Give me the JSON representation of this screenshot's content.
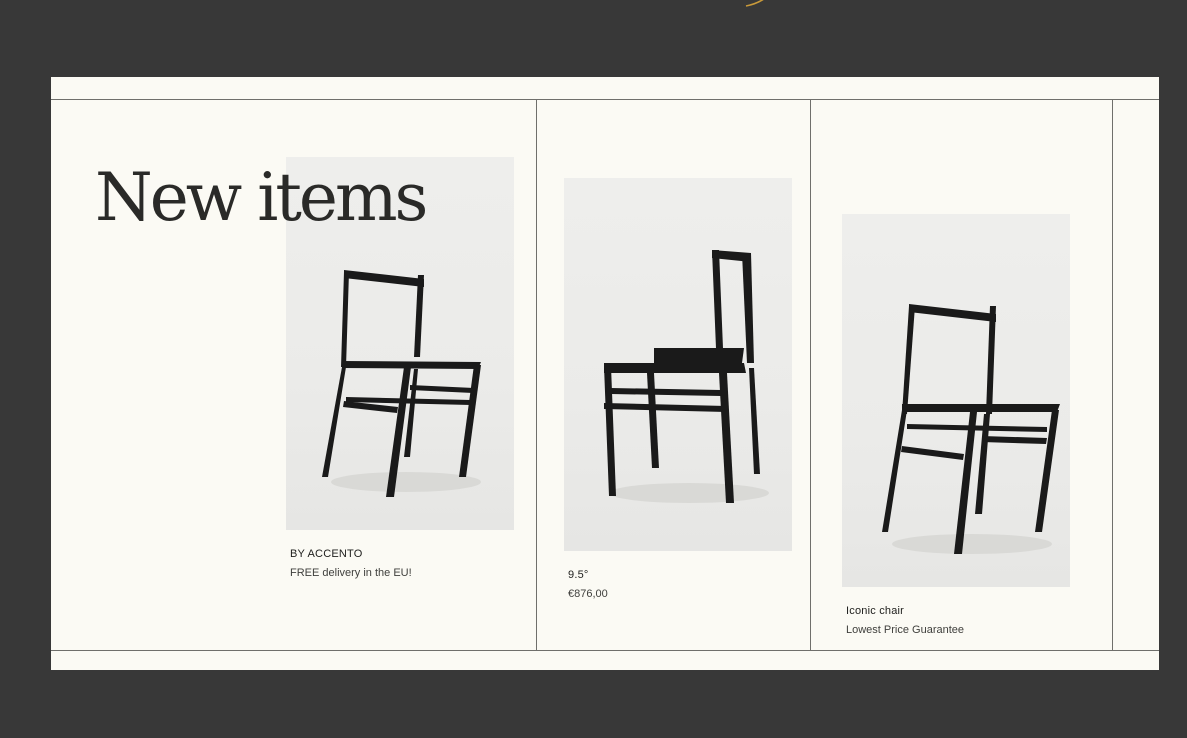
{
  "section": {
    "heading": "New items"
  },
  "products": [
    {
      "name": "BY ACCENTO",
      "detail": "FREE delivery in the EU!",
      "image": "black-chair-photo"
    },
    {
      "name": "9.5°",
      "detail": "€876,00",
      "image": "black-chair-photo"
    },
    {
      "name": "Iconic chair",
      "detail": "Lowest Price Guarantee",
      "image": "black-chair-photo"
    }
  ],
  "colors": {
    "background": "#383838",
    "panel": "#fbfaf4",
    "rule": "#6f6f6b",
    "text": "#1e1e1c",
    "accent": "#c99a3a"
  }
}
